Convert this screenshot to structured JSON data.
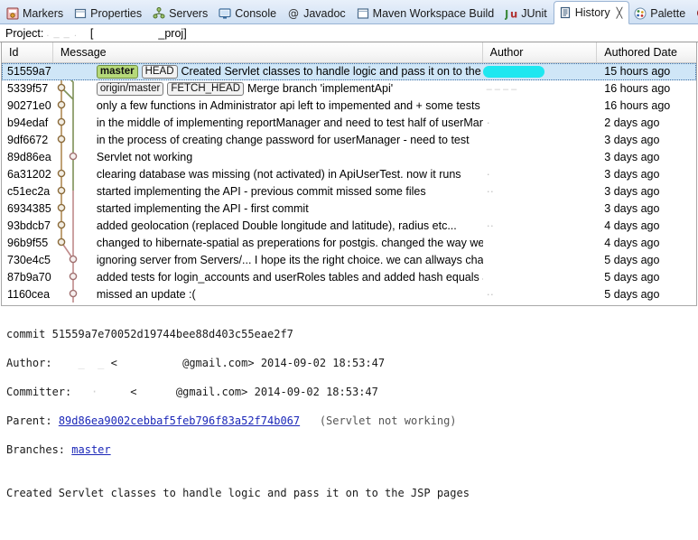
{
  "window": {
    "tabs": [
      {
        "label": "Markers",
        "icon": "markers-icon",
        "active": false,
        "closable": false
      },
      {
        "label": "Properties",
        "icon": "properties-icon",
        "active": false,
        "closable": false
      },
      {
        "label": "Servers",
        "icon": "servers-icon",
        "active": false,
        "closable": false
      },
      {
        "label": "Console",
        "icon": "console-icon",
        "active": false,
        "closable": false
      },
      {
        "label": "Javadoc",
        "icon": "javadoc-icon",
        "active": false,
        "closable": false
      },
      {
        "label": "Maven Workspace Build",
        "icon": "maven-icon",
        "active": false,
        "closable": false
      },
      {
        "label": "JUnit",
        "icon": "junit-icon",
        "active": false,
        "closable": false
      },
      {
        "label": "History",
        "icon": "history-icon",
        "active": true,
        "closable": true,
        "close_glyph": "╳"
      },
      {
        "label": "Palette",
        "icon": "palette-icon",
        "active": false,
        "closable": false
      },
      {
        "label": "",
        "icon": "error-log-icon",
        "active": false,
        "closable": false
      }
    ]
  },
  "project_bar": {
    "label": "Project:",
    "redacted_name": ".  _ _  .",
    "bracket_open": "[",
    "redacted_repo": "",
    "suffix": "_proj]"
  },
  "table": {
    "columns": [
      {
        "key": "id",
        "label": "Id"
      },
      {
        "key": "msg",
        "label": "Message"
      },
      {
        "key": "author",
        "label": "Author"
      },
      {
        "key": "date",
        "label": "Authored Date"
      }
    ],
    "rows": [
      {
        "id": "51559a7",
        "refs": [
          {
            "text": "master",
            "type": "branch"
          },
          {
            "text": "HEAD",
            "type": "head"
          }
        ],
        "message": "Created Servlet classes to handle logic and pass it on to the JSP p",
        "author": "",
        "author_redacted": "cyan",
        "date": "15 hours ago",
        "selected": true
      },
      {
        "id": "5339f57",
        "refs": [
          {
            "text": "origin/master",
            "type": "remote"
          },
          {
            "text": "FETCH_HEAD",
            "type": "head"
          }
        ],
        "message": "Merge branch 'implementApi'",
        "author": "– – – –",
        "author_redacted": "grey",
        "date": "16 hours ago",
        "selected": false
      },
      {
        "id": "90271e0",
        "refs": [],
        "message": "only a few functions in Administrator api left to impemented and + some tests + s",
        "author": "",
        "author_redacted": "none",
        "date": "16 hours ago",
        "selected": false
      },
      {
        "id": "b94edaf",
        "refs": [],
        "message": "in the middle of implementing reportManager and need to test half of userManag",
        "author": "·",
        "author_redacted": "grey",
        "date": "2 days ago",
        "selected": false
      },
      {
        "id": "9df6672",
        "refs": [],
        "message": "in the process of creating change password for userManager - need to test",
        "author": "",
        "author_redacted": "none",
        "date": "3 days ago",
        "selected": false
      },
      {
        "id": "89d86ea",
        "refs": [],
        "message": "Servlet not working",
        "author": "",
        "author_redacted": "none",
        "date": "3 days ago",
        "selected": false
      },
      {
        "id": "6a31202",
        "refs": [],
        "message": "clearing database was missing (not activated) in ApiUserTest. now it runs",
        "author": "·",
        "author_redacted": "grey",
        "date": "3 days ago",
        "selected": false
      },
      {
        "id": "c51ec2a",
        "refs": [],
        "message": "started implementing the API - previous commit missed some files",
        "author": "··",
        "author_redacted": "grey",
        "date": "3 days ago",
        "selected": false
      },
      {
        "id": "6934385",
        "refs": [],
        "message": "started implementing the API - first commit",
        "author": "",
        "author_redacted": "none",
        "date": "3 days ago",
        "selected": false
      },
      {
        "id": "93bdcb7",
        "refs": [],
        "message": "added geolocation (replaced Double longitude and latitude), radius etc...",
        "author": "··",
        "author_redacted": "grey",
        "date": "4 days ago",
        "selected": false
      },
      {
        "id": "96b9f55",
        "refs": [],
        "message": "changed to hibernate-spatial as preperations for postgis. changed the way we clear",
        "author": "",
        "author_redacted": "none",
        "date": "4 days ago",
        "selected": false
      },
      {
        "id": "730e4c5",
        "refs": [],
        "message": "ignoring server from Servers/... I hope its the right choice. we can allways change b",
        "author": "",
        "author_redacted": "none",
        "date": "5 days ago",
        "selected": false
      },
      {
        "id": "87b9a70",
        "refs": [],
        "message": "added tests for login_accounts and userRoles tables and added hash equals and toS",
        "author": "",
        "author_redacted": "none",
        "date": "5 days ago",
        "selected": false
      },
      {
        "id": "1160cea",
        "refs": [],
        "message": "missed an update :(",
        "author": "··",
        "author_redacted": "grey",
        "date": "5 days ago",
        "selected": false
      }
    ]
  },
  "detail": {
    "commit_label": "commit",
    "commit_sha": "51559a7e70052d19744bee88d403c55eae2f7",
    "author_label": "Author:",
    "author_redacted_1": "_  _",
    "author_angle_open": "<",
    "author_email": "@gmail.com>",
    "author_date": "2014-09-02 18:53:47",
    "committer_label": "Committer:",
    "committer_redacted_1": "·",
    "committer_angle_open": "<",
    "committer_email": "@gmail.com>",
    "committer_date": "2014-09-02 18:53:47",
    "parent_label": "Parent:",
    "parent_sha": "89d86ea9002cebbaf5feb796f83a52f74b067",
    "parent_subject": "(Servlet not working)",
    "branches_label": "Branches:",
    "branches_value": "master",
    "body": "Created Servlet classes to handle logic and pass it on to the JSP pages"
  },
  "colors": {
    "tab_active_bg": "#ffffff",
    "tabbar_bg": "#dce8f7",
    "selection_bg": "#cfe6f7",
    "branch_label_bg": "#b6d97a",
    "redaction_cyan": "#1ee7f0",
    "graph_lane_1": "#b08b54",
    "graph_lane_2": "#7f9158",
    "graph_lane_3": "#c08a8a",
    "link_blue": "#1b27b8"
  }
}
